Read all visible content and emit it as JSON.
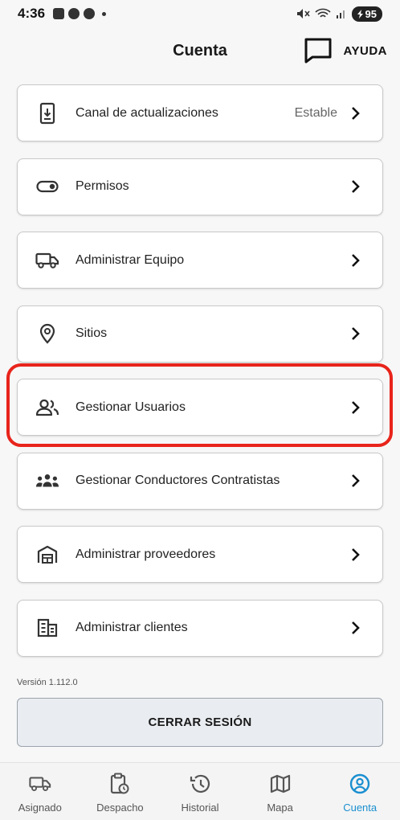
{
  "status_bar": {
    "time": "4:36",
    "battery": "95"
  },
  "header": {
    "title": "Cuenta",
    "help_label": "AYUDA"
  },
  "menu": {
    "items": [
      {
        "label": "Canal de actualizaciones",
        "value": "Estable",
        "icon": "download-phone-icon"
      },
      {
        "label": "Permisos",
        "icon": "toggle-icon"
      },
      {
        "label": "Administrar Equipo",
        "icon": "truck-icon"
      },
      {
        "label": "Sitios",
        "icon": "location-pin-icon"
      },
      {
        "label": "Gestionar Usuarios",
        "icon": "users-icon"
      },
      {
        "label": "Gestionar Conductores Contratistas",
        "icon": "group-icon"
      },
      {
        "label": "Administrar proveedores",
        "icon": "warehouse-icon"
      },
      {
        "label": "Administrar clientes",
        "icon": "building-icon"
      }
    ]
  },
  "highlight_color": "#e8241b",
  "version": "Versión 1.112.0",
  "logout_label": "CERRAR SESIÓN",
  "bottom_nav": {
    "items": [
      {
        "label": "Asignado",
        "icon": "truck-icon"
      },
      {
        "label": "Despacho",
        "icon": "clipboard-clock-icon"
      },
      {
        "label": "Historial",
        "icon": "history-icon"
      },
      {
        "label": "Mapa",
        "icon": "map-icon"
      },
      {
        "label": "Cuenta",
        "icon": "account-icon",
        "active": true
      }
    ],
    "active_color": "#1a8fd0"
  }
}
